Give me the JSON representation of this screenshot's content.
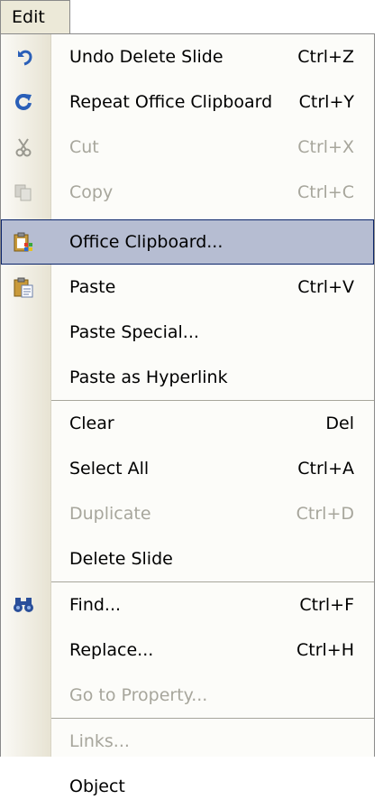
{
  "menu": {
    "title": "Edit",
    "items": [
      {
        "label": "Undo Delete Slide",
        "shortcut": "Ctrl+Z",
        "icon": "undo-icon",
        "enabled": true
      },
      {
        "label": "Repeat Office Clipboard",
        "shortcut": "Ctrl+Y",
        "icon": "repeat-icon",
        "enabled": true
      },
      {
        "label": "Cut",
        "shortcut": "Ctrl+X",
        "icon": "scissors-icon",
        "enabled": false
      },
      {
        "label": "Copy",
        "shortcut": "Ctrl+C",
        "icon": "copy-icon",
        "enabled": false
      },
      {
        "label": "Office Clipboard...",
        "shortcut": "",
        "icon": "office-clipboard-icon",
        "enabled": true,
        "highlighted": true
      },
      {
        "label": "Paste",
        "shortcut": "Ctrl+V",
        "icon": "paste-icon",
        "enabled": true
      },
      {
        "label": "Paste Special...",
        "shortcut": "",
        "enabled": true
      },
      {
        "label": "Paste as Hyperlink",
        "shortcut": "",
        "enabled": true
      },
      {
        "label": "Clear",
        "shortcut": "Del",
        "enabled": true
      },
      {
        "label": "Select All",
        "shortcut": "Ctrl+A",
        "enabled": true
      },
      {
        "label": "Duplicate",
        "shortcut": "Ctrl+D",
        "enabled": false
      },
      {
        "label": "Delete Slide",
        "shortcut": "",
        "enabled": true
      },
      {
        "label": "Find...",
        "shortcut": "Ctrl+F",
        "icon": "binoculars-icon",
        "enabled": true
      },
      {
        "label": "Replace...",
        "shortcut": "Ctrl+H",
        "enabled": true
      },
      {
        "label": "Go to Property...",
        "shortcut": "",
        "enabled": false
      },
      {
        "label": "Links...",
        "shortcut": "",
        "enabled": false
      },
      {
        "label": "Object",
        "shortcut": "",
        "enabled": true
      }
    ]
  },
  "colors": {
    "highlight": "#b6bdd2",
    "highlight_border": "#0a246a",
    "disabled_text": "#a7a69c"
  }
}
